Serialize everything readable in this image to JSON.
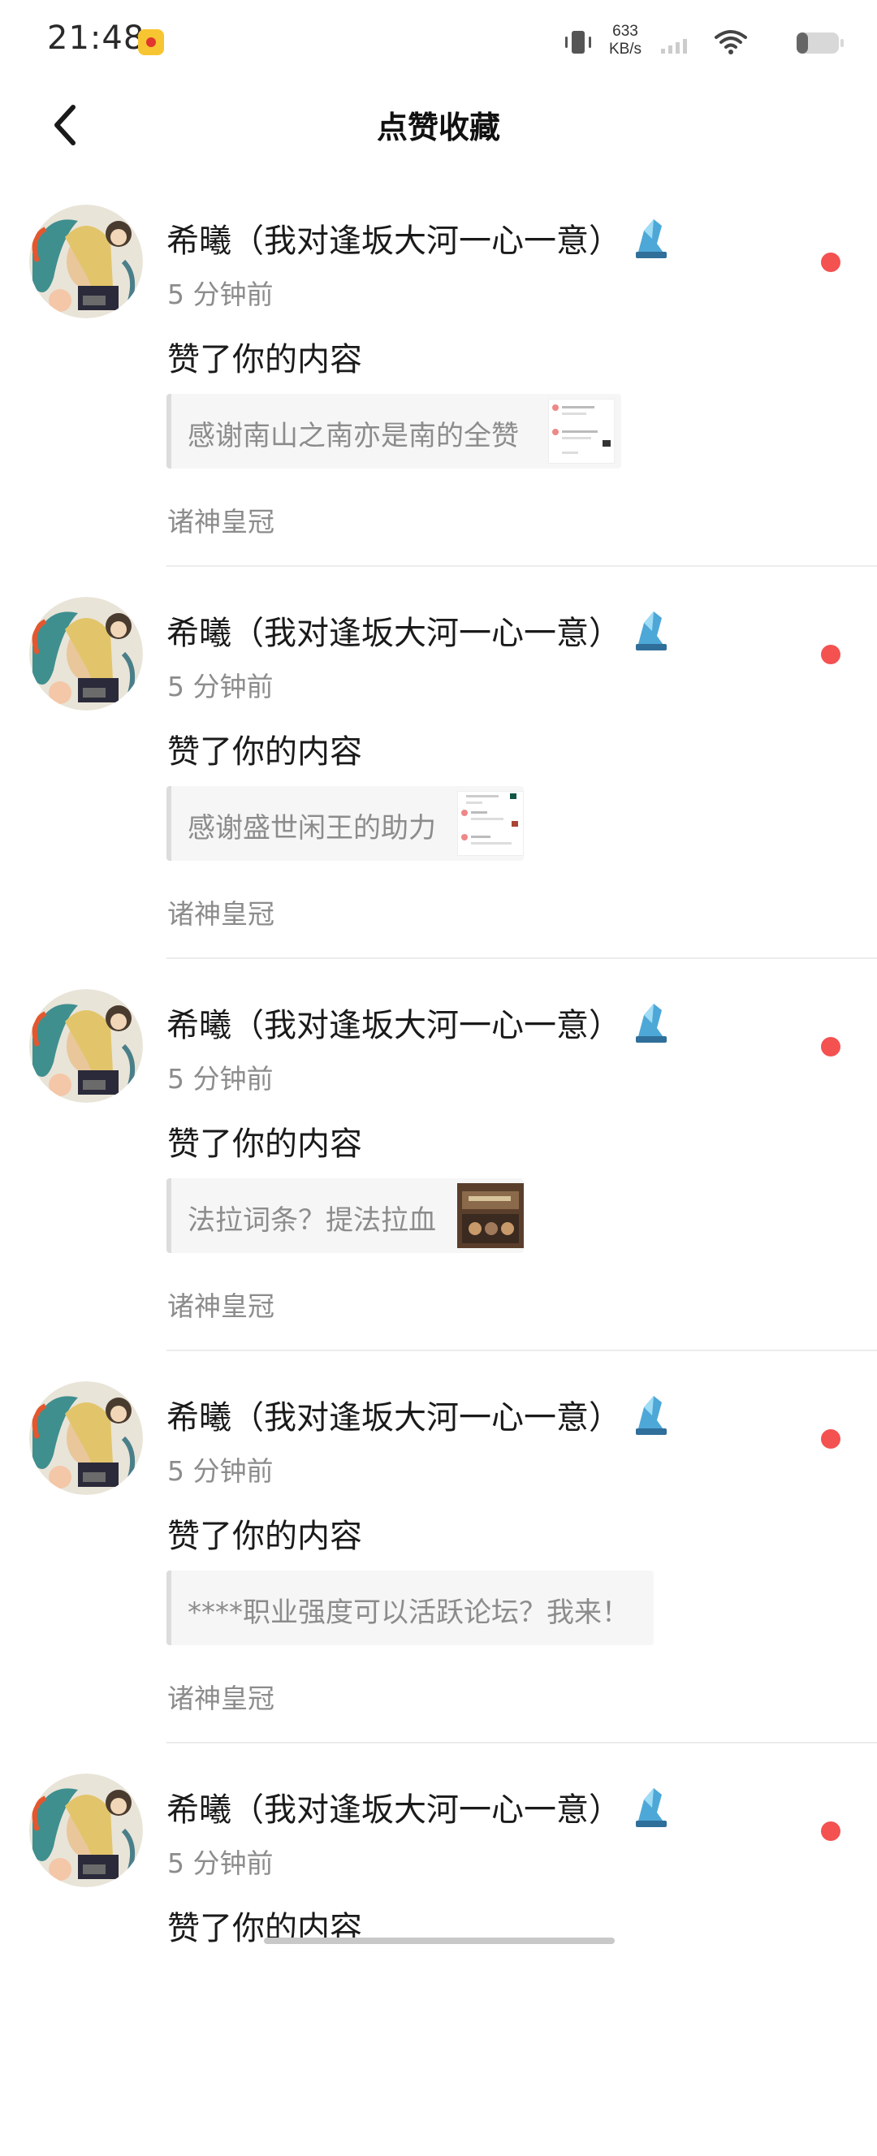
{
  "status_bar": {
    "time": "21:48",
    "net_speed_value": "633",
    "net_speed_unit": "KB/s",
    "icons": [
      "app-badge-icon",
      "vibrate-icon",
      "signal-icon",
      "wifi-icon",
      "battery-icon"
    ]
  },
  "header": {
    "title": "点赞收藏",
    "back_icon": "chevron-left-icon"
  },
  "colors": {
    "unread_dot": "#f45151",
    "secondary_text": "#8c8c8c",
    "quote_bg": "#f6f6f6"
  },
  "notifications": [
    {
      "username": "希曦（我对逢坂大河一心一意）",
      "time": "5 分钟前",
      "action": "赞了你的内容",
      "quote": "感谢南山之南亦是南的全赞",
      "category": "诸神皇冠",
      "unread": true
    },
    {
      "username": "希曦（我对逢坂大河一心一意）",
      "time": "5 分钟前",
      "action": "赞了你的内容",
      "quote": "感谢盛世闲王的助力",
      "category": "诸神皇冠",
      "unread": true
    },
    {
      "username": "希曦（我对逢坂大河一心一意）",
      "time": "5 分钟前",
      "action": "赞了你的内容",
      "quote": "法拉词条？提法拉血",
      "category": "诸神皇冠",
      "unread": true
    },
    {
      "username": "希曦（我对逢坂大河一心一意）",
      "time": "5 分钟前",
      "action": "赞了你的内容",
      "quote": "****职业强度可以活跃论坛？我来！",
      "category": "诸神皇冠",
      "unread": true
    },
    {
      "username": "希曦（我对逢坂大河一心一意）",
      "time": "5 分钟前",
      "action": "赞了你的内容",
      "quote": "",
      "category": "",
      "unread": true
    }
  ]
}
